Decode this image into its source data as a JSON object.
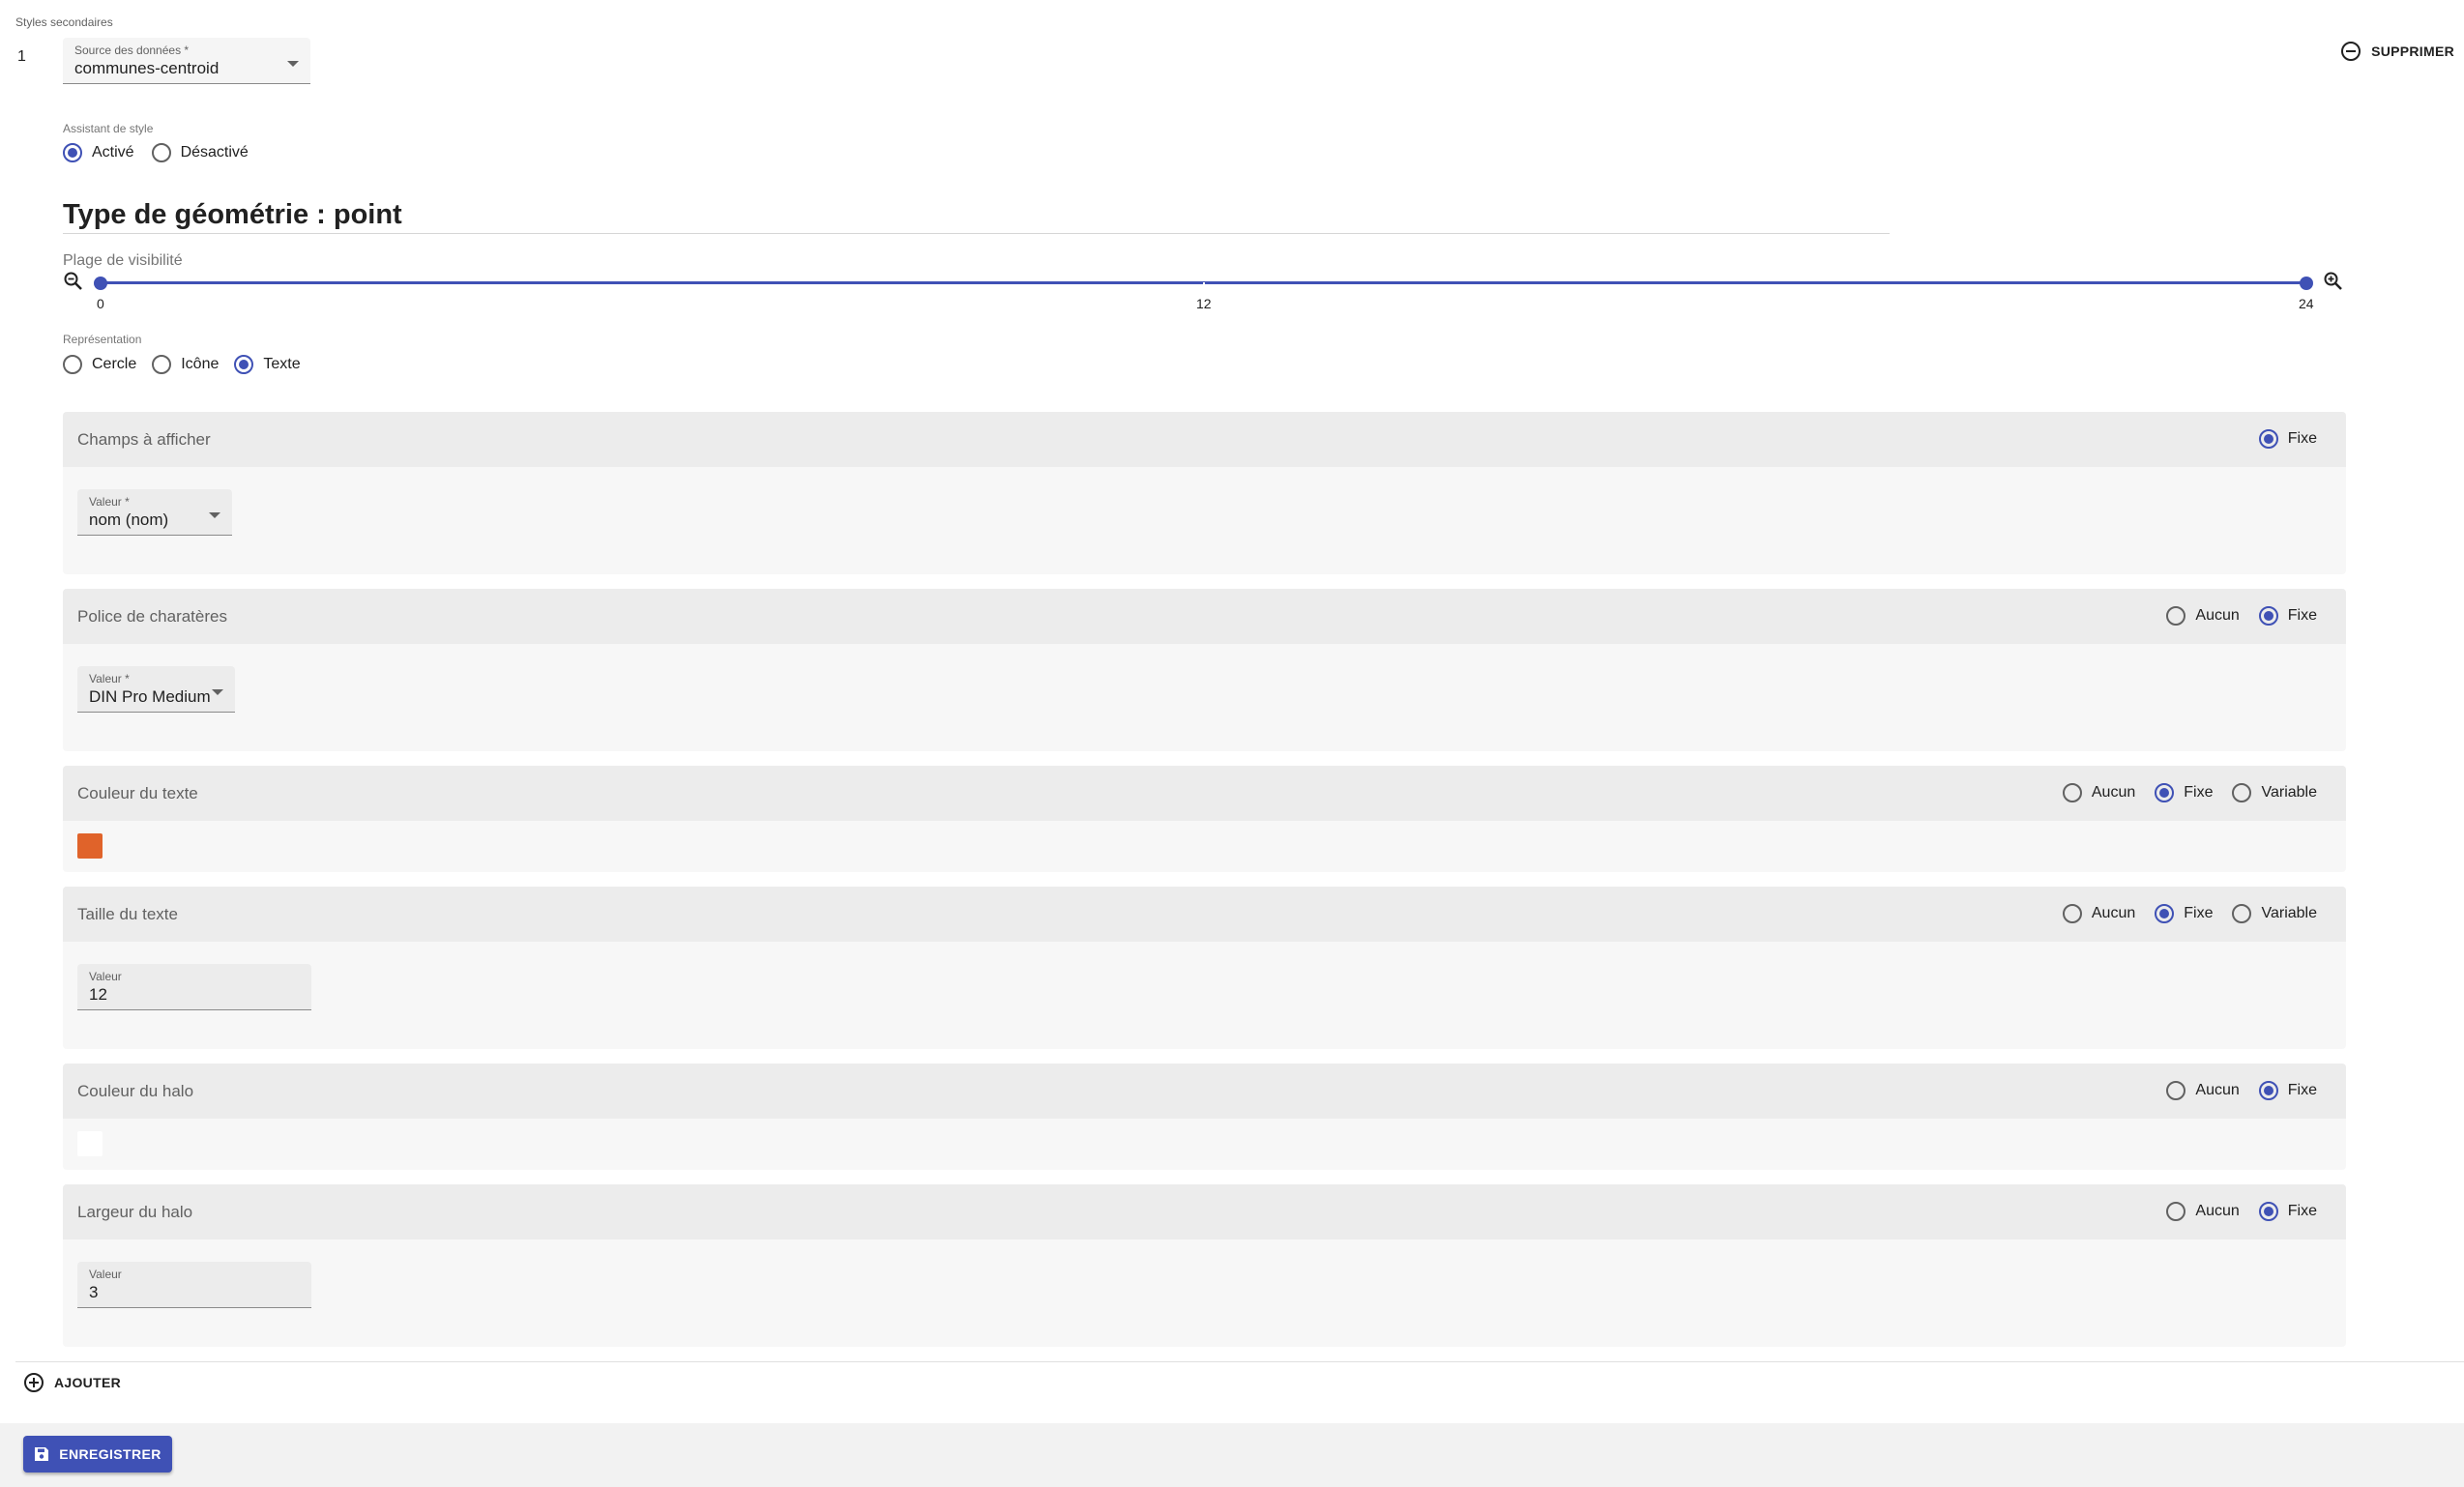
{
  "section_title": "Styles secondaires",
  "item_index": "1",
  "source": {
    "label": "Source des données *",
    "value": "communes-centroid"
  },
  "delete_label": "SUPPRIMER",
  "style_assistant": {
    "label": "Assistant de style",
    "options": [
      {
        "label": "Activé",
        "checked": true
      },
      {
        "label": "Désactivé",
        "checked": false
      }
    ]
  },
  "geometry_title": "Type de géométrie : point",
  "visibility": {
    "label": "Plage de visibilité",
    "min": 0,
    "mid": 12,
    "max": 24,
    "range": [
      0,
      24
    ]
  },
  "representation": {
    "label": "Représentation",
    "options": [
      {
        "label": "Cercle",
        "checked": false
      },
      {
        "label": "Icône",
        "checked": false
      },
      {
        "label": "Texte",
        "checked": true
      }
    ]
  },
  "panels": {
    "fields": {
      "title": "Champs à afficher",
      "options": [
        {
          "label": "Fixe",
          "checked": true
        }
      ],
      "field": {
        "label": "Valeur *",
        "value": "nom (nom)"
      }
    },
    "font": {
      "title": "Police de charatères",
      "options": [
        {
          "label": "Aucun",
          "checked": false
        },
        {
          "label": "Fixe",
          "checked": true
        }
      ],
      "field": {
        "label": "Valeur *",
        "value": "DIN Pro Medium"
      }
    },
    "text_color": {
      "title": "Couleur du texte",
      "options": [
        {
          "label": "Aucun",
          "checked": false
        },
        {
          "label": "Fixe",
          "checked": true
        },
        {
          "label": "Variable",
          "checked": false
        }
      ],
      "color": "#e0632a"
    },
    "text_size": {
      "title": "Taille du texte",
      "options": [
        {
          "label": "Aucun",
          "checked": false
        },
        {
          "label": "Fixe",
          "checked": true
        },
        {
          "label": "Variable",
          "checked": false
        }
      ],
      "field": {
        "label": "Valeur",
        "value": "12"
      }
    },
    "halo_color": {
      "title": "Couleur du halo",
      "options": [
        {
          "label": "Aucun",
          "checked": false
        },
        {
          "label": "Fixe",
          "checked": true
        }
      ],
      "color": "#ffffff"
    },
    "halo_width": {
      "title": "Largeur du halo",
      "options": [
        {
          "label": "Aucun",
          "checked": false
        },
        {
          "label": "Fixe",
          "checked": true
        }
      ],
      "field": {
        "label": "Valeur",
        "value": "3"
      }
    }
  },
  "add_label": "AJOUTER",
  "save_label": "ENREGISTRER",
  "colors": {
    "accent": "#3f51b5"
  }
}
